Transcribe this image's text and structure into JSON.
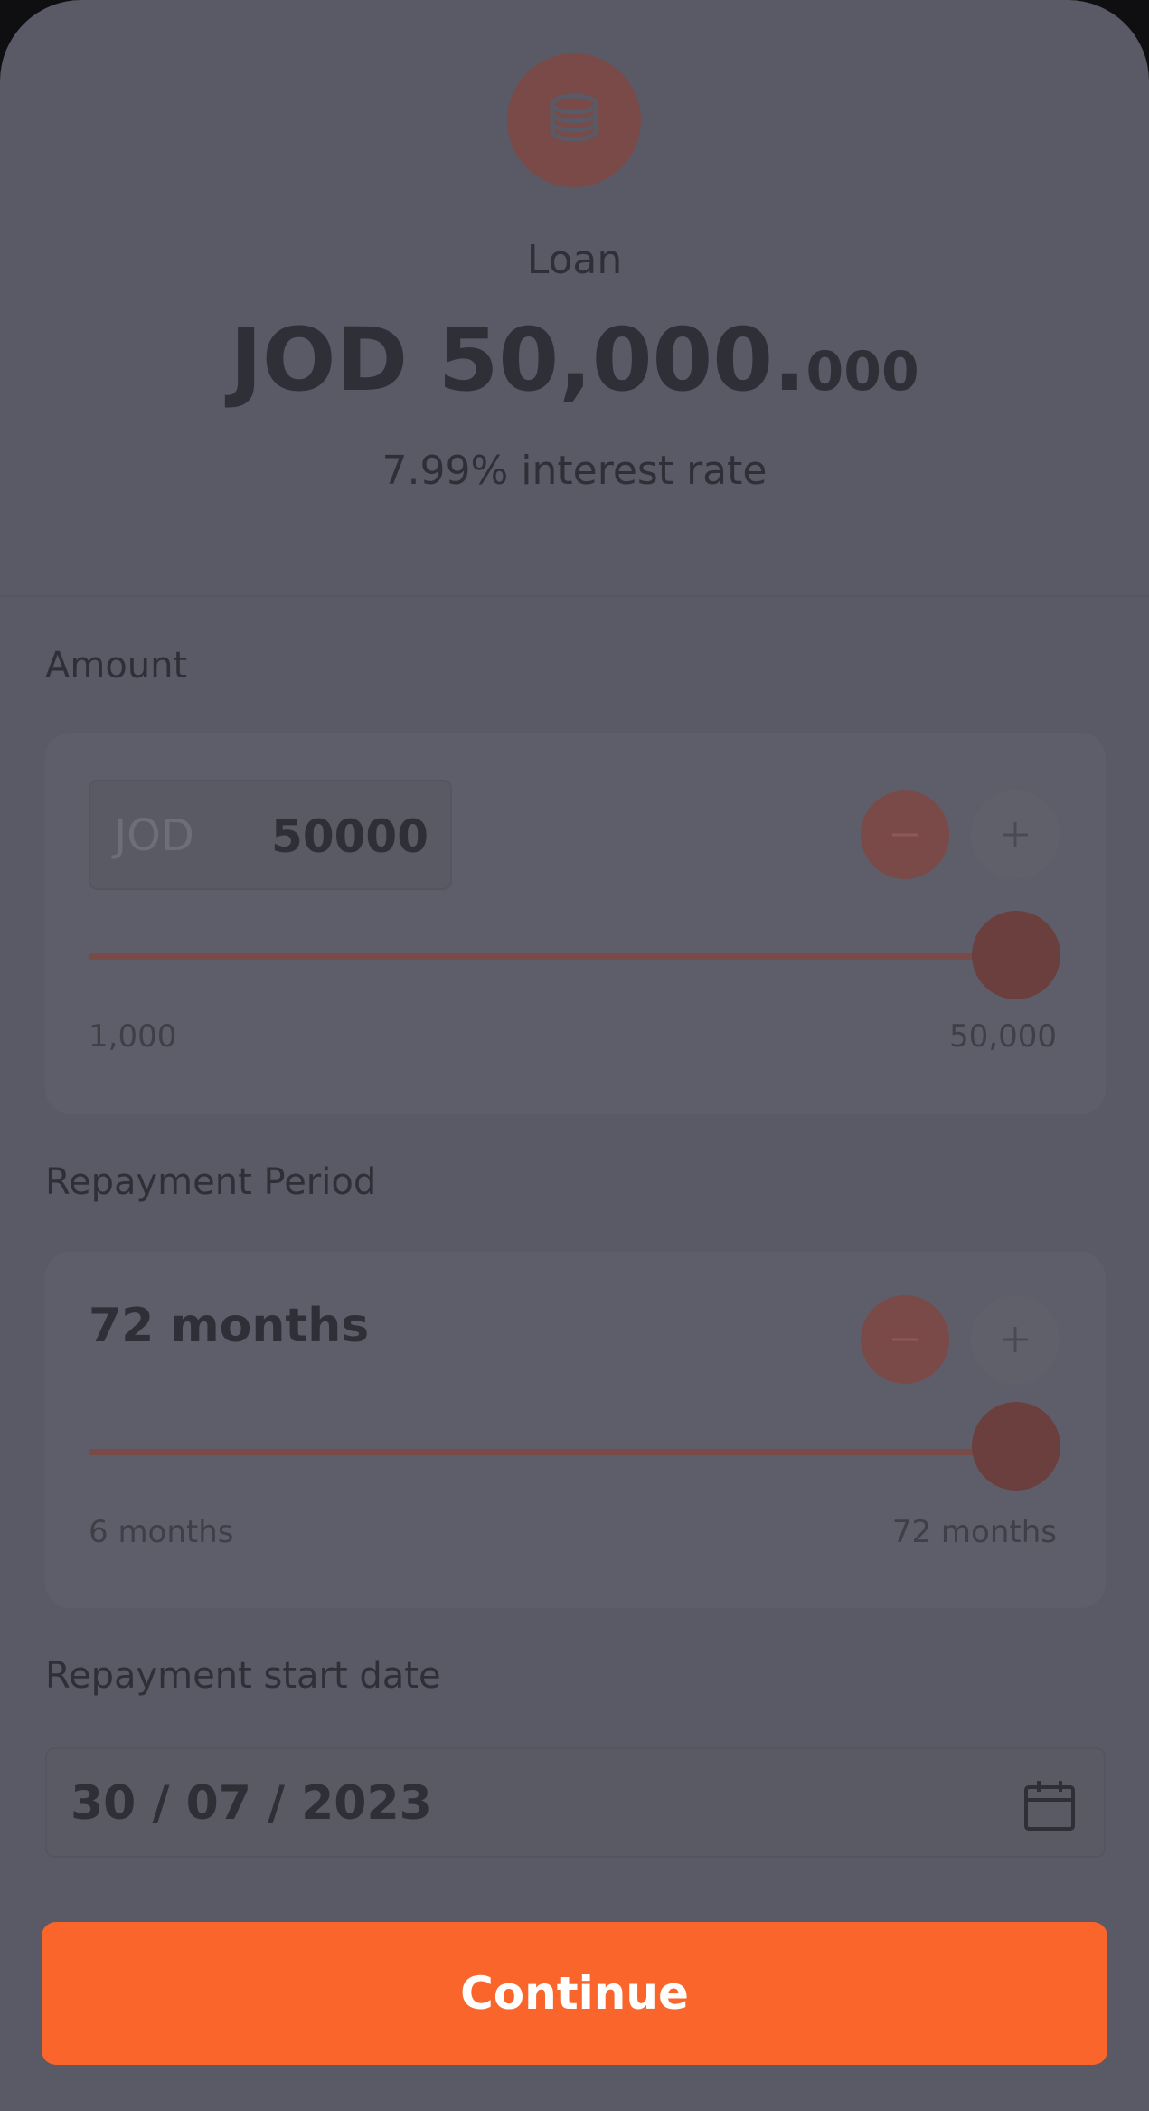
{
  "header": {
    "icon": "coin-stack-icon",
    "title": "Loan",
    "amount_main": "JOD 50,000.",
    "amount_decimals": "000",
    "interest_rate": "7.99% interest rate"
  },
  "amount_section": {
    "label": "Amount",
    "currency": "JOD",
    "value": "50000",
    "min_label": "1,000",
    "max_label": "50,000",
    "slider_fraction": 1.0
  },
  "period_section": {
    "label": "Repayment Period",
    "value": "72 months",
    "min_label": "6 months",
    "max_label": "72 months",
    "slider_fraction": 1.0
  },
  "start_date_section": {
    "label": "Repayment start date",
    "value": "30 / 07 / 2023"
  },
  "continue_label": "Continue",
  "colors": {
    "accent": "#f9652a",
    "overlay_background": "#5a5a66"
  }
}
